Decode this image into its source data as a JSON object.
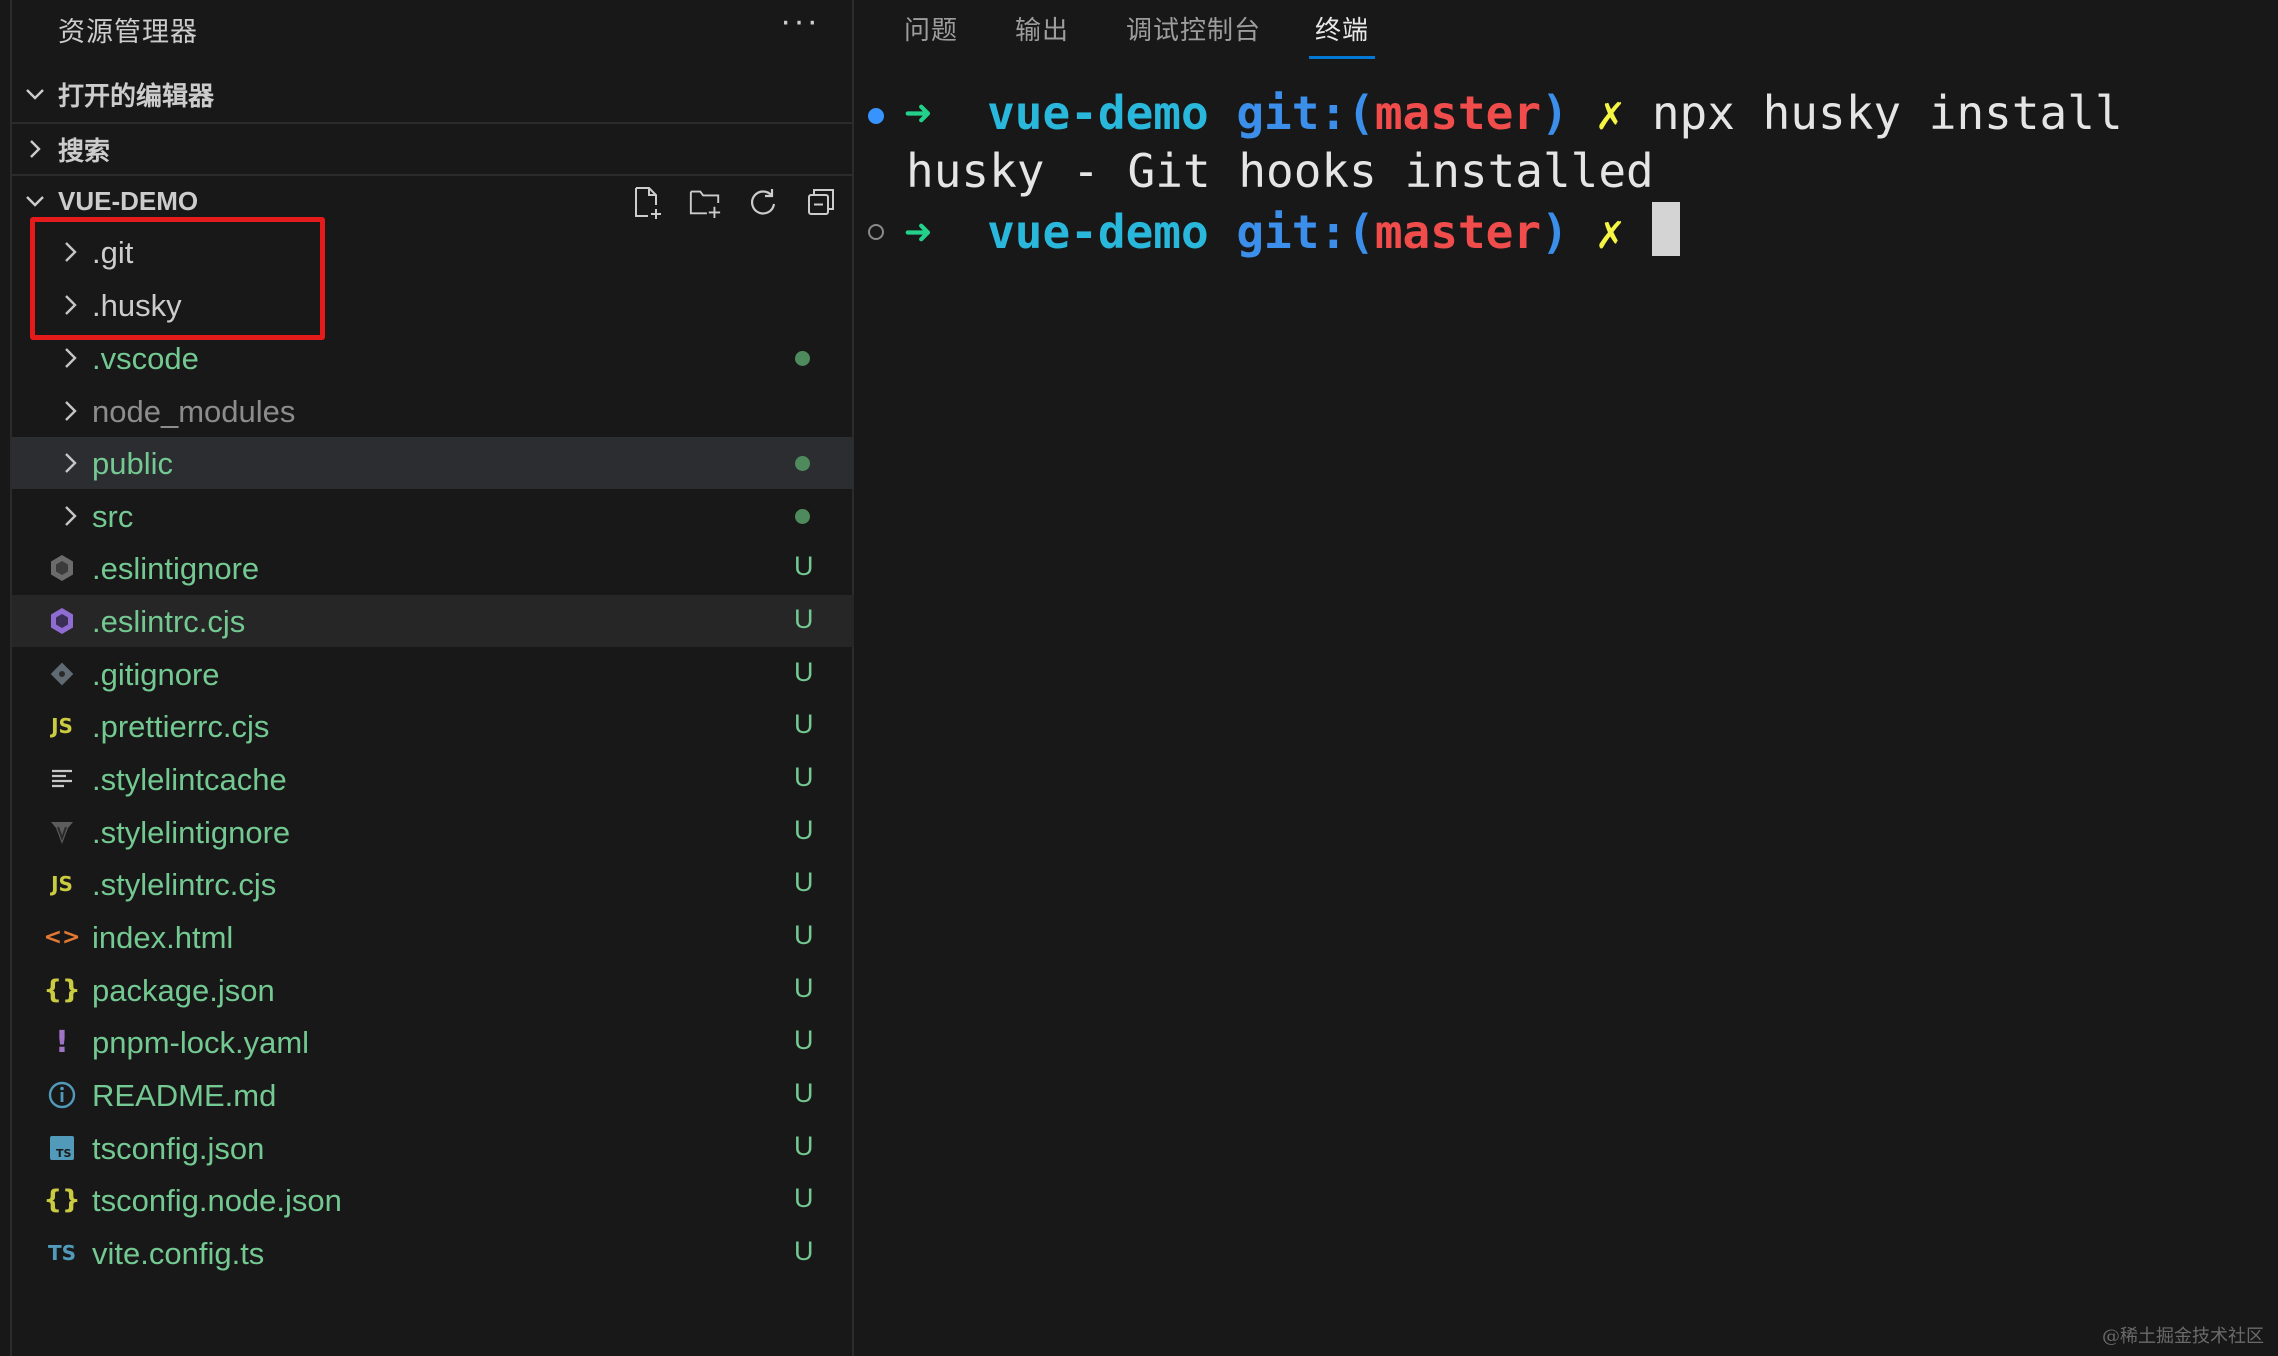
{
  "explorer": {
    "title": "资源管理器",
    "more": "···",
    "sections": {
      "open_editors": "打开的编辑器",
      "search": "搜索",
      "project": "VUE-DEMO"
    },
    "tree": [
      {
        "name": ".git",
        "kind": "folder",
        "color": "white",
        "deco": ""
      },
      {
        "name": ".husky",
        "kind": "folder",
        "color": "white",
        "deco": ""
      },
      {
        "name": ".vscode",
        "kind": "folder",
        "color": "green",
        "deco": "dot"
      },
      {
        "name": "node_modules",
        "kind": "folder",
        "color": "grey",
        "deco": ""
      },
      {
        "name": "public",
        "kind": "folder",
        "color": "green",
        "deco": "dot"
      },
      {
        "name": "src",
        "kind": "folder",
        "color": "green",
        "deco": "dot"
      },
      {
        "name": ".eslintignore",
        "kind": "file",
        "icon": "eslint-ignore-icon",
        "color": "green",
        "deco": "U"
      },
      {
        "name": ".eslintrc.cjs",
        "kind": "file",
        "icon": "eslint-icon",
        "color": "green",
        "deco": "U"
      },
      {
        "name": ".gitignore",
        "kind": "file",
        "icon": "git-icon",
        "color": "green",
        "deco": "U"
      },
      {
        "name": ".prettierrc.cjs",
        "kind": "file",
        "icon": "js-icon",
        "color": "green",
        "deco": "U"
      },
      {
        "name": ".stylelintcache",
        "kind": "file",
        "icon": "text-lines-icon",
        "color": "green",
        "deco": "U"
      },
      {
        "name": ".stylelintignore",
        "kind": "file",
        "icon": "stylelint-icon",
        "color": "green",
        "deco": "U"
      },
      {
        "name": ".stylelintrc.cjs",
        "kind": "file",
        "icon": "js-icon",
        "color": "green",
        "deco": "U"
      },
      {
        "name": "index.html",
        "kind": "file",
        "icon": "html-icon",
        "color": "green",
        "deco": "U"
      },
      {
        "name": "package.json",
        "kind": "file",
        "icon": "json-icon",
        "color": "green",
        "deco": "U"
      },
      {
        "name": "pnpm-lock.yaml",
        "kind": "file",
        "icon": "yaml-icon",
        "color": "green",
        "deco": "U"
      },
      {
        "name": "README.md",
        "kind": "file",
        "icon": "info-icon",
        "color": "green",
        "deco": "U"
      },
      {
        "name": "tsconfig.json",
        "kind": "file",
        "icon": "tsconfig-icon",
        "color": "green",
        "deco": "U"
      },
      {
        "name": "tsconfig.node.json",
        "kind": "file",
        "icon": "json-icon",
        "color": "green",
        "deco": "U"
      },
      {
        "name": "vite.config.ts",
        "kind": "file",
        "icon": "ts-icon",
        "color": "green",
        "deco": "U"
      }
    ],
    "glyphs": {
      "js": "JS",
      "ts": "TS",
      "json": "{}",
      "yaml": "!",
      "html": "<>"
    }
  },
  "panel": {
    "tabs": [
      "问题",
      "输出",
      "调试控制台",
      "终端"
    ],
    "active_tab": "终端",
    "terminal": {
      "arrow": "➜",
      "dir": "vue-demo",
      "git_label": "git:(",
      "branch": "master",
      "git_close": ")",
      "dirty": "✗",
      "command": "npx husky install",
      "output": "husky - Git hooks installed"
    }
  },
  "watermark": "@稀土掘金技术社区",
  "colors": {
    "untracked": "#73c991",
    "highlight_box": "#e51b1b",
    "active_tab_underline": "#0078d4"
  }
}
